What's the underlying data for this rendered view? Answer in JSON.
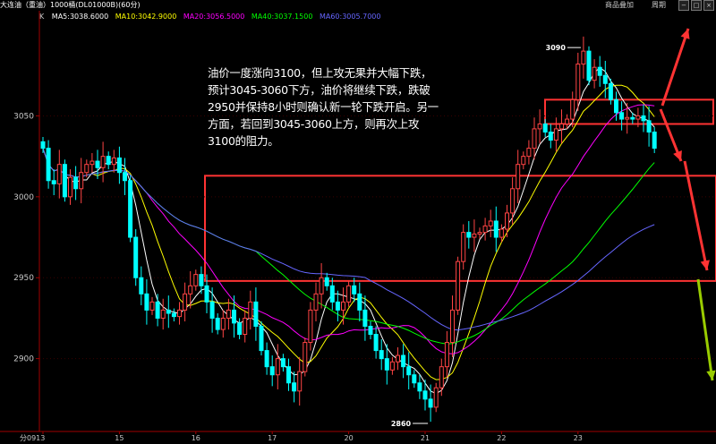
{
  "header": {
    "code_k": "K",
    "instrument": "大连油（重油）1000桶(DL01000B)(60分)",
    "menu_add": "商品叠加",
    "menu_period": "周期"
  },
  "ma_legend": [
    {
      "label": "MA5:3038.6000",
      "color": "#ffffff"
    },
    {
      "label": "MA10:3042.9000",
      "color": "#ffff00"
    },
    {
      "label": "MA20:3056.5000",
      "color": "#ff00ff"
    },
    {
      "label": "MA40:3037.1500",
      "color": "#00ff00"
    },
    {
      "label": "MA60:3005.7000",
      "color": "#6666ff"
    }
  ],
  "annotation": "油价一度涨向3100，但上攻无果并大幅下跌，预计3045-3060下方，油价将继续下跌，跌破2950并保持8小时则确认新一轮下跌开启。另一方面，若回到3045-3060上方，则再次上攻3100的阻力。",
  "chart_data": {
    "type": "candlestick",
    "ylim": [
      2855,
      3105
    ],
    "y_ticks": [
      3050,
      3000,
      2950,
      2900
    ],
    "x_ticks": [
      "分0913",
      "15",
      "16",
      "17",
      "20",
      "21",
      "22",
      "23"
    ],
    "high_label": "3090",
    "low_label": "2860",
    "zones": [
      {
        "name": "resistance",
        "from": 3045,
        "to": 3060
      },
      {
        "name": "support",
        "from": 2948,
        "to": 3013
      }
    ],
    "colors": {
      "up": "#ff4444",
      "down": "#00ffff",
      "axis": "#a00000",
      "zone": "#ff3333"
    },
    "closes": [
      3030,
      3010,
      3008,
      3020,
      3000,
      3012,
      3005,
      3015,
      3020,
      3022,
      3018,
      3025,
      3020,
      3024,
      3015,
      3010,
      2975,
      2950,
      2940,
      2930,
      2935,
      2925,
      2930,
      2928,
      2926,
      2930,
      2940,
      2945,
      2952,
      2945,
      2935,
      2925,
      2918,
      2925,
      2930,
      2922,
      2915,
      2925,
      2935,
      2920,
      2905,
      2895,
      2890,
      2900,
      2895,
      2885,
      2880,
      2892,
      2910,
      2930,
      2940,
      2950,
      2945,
      2935,
      2930,
      2935,
      2945,
      2940,
      2930,
      2920,
      2915,
      2905,
      2900,
      2893,
      2898,
      2902,
      2895,
      2890,
      2885,
      2880,
      2875,
      2870,
      2882,
      2895,
      2910,
      2930,
      2960,
      2978,
      2975,
      2977,
      2978,
      2982,
      2985,
      2975,
      2980,
      2990,
      3005,
      3020,
      3025,
      3030,
      3042,
      3045,
      3040,
      3035,
      3042,
      3045,
      3048,
      3060,
      3082,
      3090,
      3072,
      3080,
      3075,
      3070,
      3060,
      3052,
      3048,
      3049,
      3048,
      3050,
      3047,
      3040,
      3030
    ]
  }
}
